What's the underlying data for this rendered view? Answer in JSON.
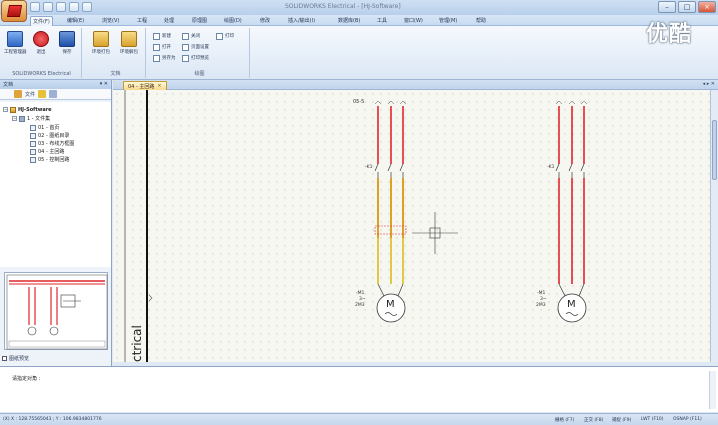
{
  "title_bar": {
    "window_title": "SOLIDWORKS Electrical - [HJ-Software]",
    "minimize_label": "–",
    "maximize_label": "□",
    "close_label": "×"
  },
  "menu_tabs": [
    {
      "label": "文件(F)",
      "active": true
    },
    {
      "label": "编辑(E)",
      "active": false
    },
    {
      "label": "浏览(V)",
      "active": false
    },
    {
      "label": "工程",
      "active": false
    },
    {
      "label": "处理",
      "active": false
    },
    {
      "label": "原理图",
      "active": false
    },
    {
      "label": "绘图(D)",
      "active": false
    },
    {
      "label": "修改",
      "active": false
    },
    {
      "label": "插入/输出(I)",
      "active": false
    },
    {
      "label": "数据库(B)",
      "active": false
    },
    {
      "label": "工具",
      "active": false
    },
    {
      "label": "窗口(W)",
      "active": false
    },
    {
      "label": "管理(M)",
      "active": false
    },
    {
      "label": "帮助",
      "active": false
    }
  ],
  "ribbon": {
    "group1": {
      "label": "SOLIDWORKS Electrical",
      "buttons": [
        {
          "label": "工程管理器",
          "icon": "project-manager-icon",
          "color": "#3a7bd5"
        },
        {
          "label": "退出",
          "icon": "exit-icon",
          "color": "#d8262a"
        },
        {
          "label": "保存",
          "icon": "save-icon",
          "color": "#2a5fb8"
        }
      ]
    },
    "group2": {
      "label": "文档",
      "buttons": [
        {
          "label": "环境打包",
          "icon": "pack-folder-icon",
          "color": "#e9b63c"
        },
        {
          "label": "环境解包",
          "icon": "unpack-folder-icon",
          "color": "#e9b63c"
        }
      ]
    },
    "group3": {
      "label": "绘图",
      "small_buttons": [
        "新建",
        "打开",
        "页面设置",
        "关闭",
        "打印",
        "打印预览",
        "另存为"
      ]
    }
  },
  "left_panel": {
    "title": "文档",
    "tab_label": "文件",
    "tree": {
      "root": "HJ-Software",
      "book": "1 - 文件集",
      "items": [
        "01 - 首页",
        "02 - 图纸目录",
        "03 - 布线方框图",
        "04 - 主回路",
        "05 - 控制回路"
      ]
    },
    "footer_checkbox": "图纸预览"
  },
  "document_tab": {
    "label": "04 - 主回路",
    "close": "×"
  },
  "drawing": {
    "title_block_text": "ctrical",
    "sheet_ref": "05-5",
    "left_motor": {
      "ref": "-M1",
      "poles": "3~",
      "rating": "2M3",
      "contactor": "-K1",
      "symbol": "M"
    },
    "right_motor": {
      "ref": "-M1",
      "poles": "3~",
      "rating": "2M3",
      "contactor": "-K1",
      "symbol": "M"
    }
  },
  "command": {
    "prompt": "请指定对角 :"
  },
  "status_bar": {
    "coords": "(X) X : 128.75565043 ; Y : 106.9834801776",
    "toggles": [
      "栅格 (F7)",
      "正交 (F8)",
      "捕捉 (F9)",
      "LWT (F10)",
      "OSNAP (F11)"
    ]
  },
  "watermark": "优酷",
  "colors": {
    "wire_red": "#e0262b",
    "wire_yellow": "#d8b400",
    "crosshair": "#333333"
  }
}
